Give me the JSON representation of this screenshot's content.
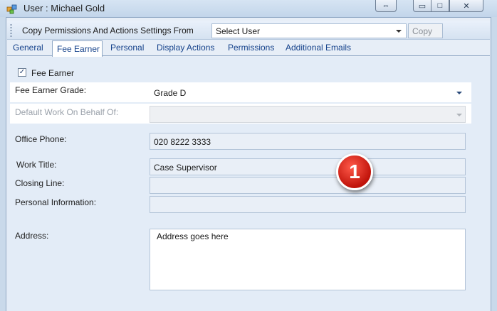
{
  "window": {
    "title": "User : Michael Gold",
    "controls": {
      "minimize": "▭",
      "maximize": "□",
      "close": "✕",
      "swap": "⇔"
    }
  },
  "copybar": {
    "label": "Copy Permissions And Actions Settings From",
    "select_value": "Select User",
    "copy_button": "Copy"
  },
  "tabs": [
    {
      "label": "General",
      "active": false
    },
    {
      "label": "Fee Earner",
      "active": true
    },
    {
      "label": "Personal",
      "active": false
    },
    {
      "label": "Display Actions",
      "active": false
    },
    {
      "label": "Permissions",
      "active": false
    },
    {
      "label": "Additional Emails",
      "active": false
    }
  ],
  "form": {
    "fee_earner_checkbox": {
      "label": "Fee Earner",
      "checked": true,
      "mark": "✓"
    },
    "grade": {
      "label": "Fee Earner Grade:",
      "value": "Grade D"
    },
    "behalf": {
      "label": "Default Work On Behalf Of:",
      "value": ""
    },
    "office_phone": {
      "label": "Office Phone:",
      "value": "020 8222 3333"
    },
    "work_title": {
      "label": "Work Title:",
      "value": "Case Supervisor"
    },
    "closing_line": {
      "label": "Closing Line:",
      "value": ""
    },
    "personal_info": {
      "label": "Personal Information:",
      "value": ""
    },
    "address": {
      "label": "Address:",
      "value": "Address goes here"
    }
  },
  "callout": {
    "number": "1",
    "color": "#d4190f"
  }
}
